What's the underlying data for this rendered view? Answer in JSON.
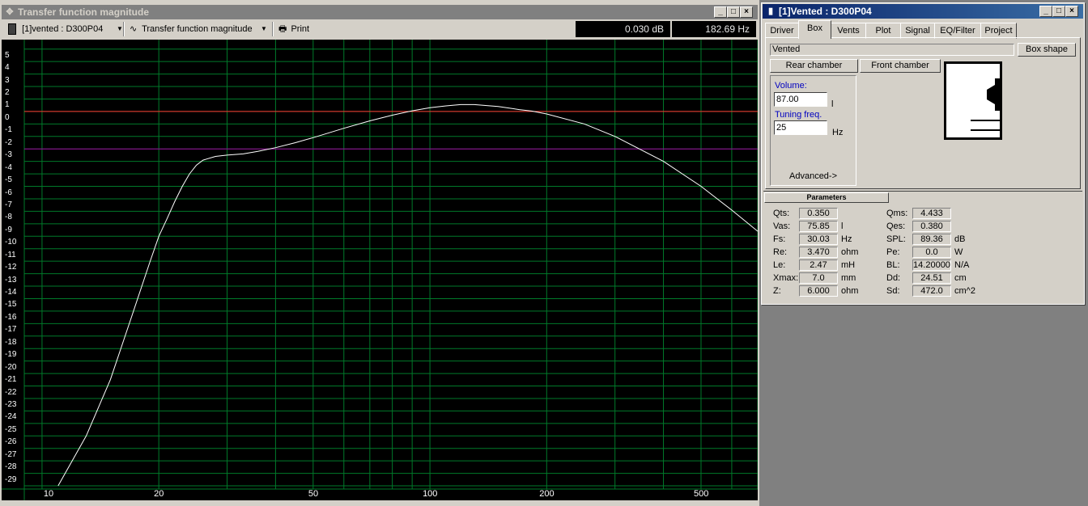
{
  "left_window": {
    "title": "Transfer function magnitude",
    "toolbar": {
      "project_select": "[1]vented : D300P04",
      "view_select": "Transfer function magnitude",
      "print_label": "Print",
      "readout_db": "0.030 dB",
      "readout_hz": "182.69 Hz"
    }
  },
  "chart_data": {
    "type": "line",
    "xscale": "log",
    "xlim": [
      9,
      700
    ],
    "ylim": [
      -30,
      5.5
    ],
    "x_ticks": [
      "10",
      "20",
      "50",
      "100",
      "200",
      "500"
    ],
    "y_ticks": [
      "5",
      "4",
      "3",
      "2",
      "1",
      "0",
      "-1",
      "-2",
      "-3",
      "-4",
      "-5",
      "-6",
      "-7",
      "-8",
      "-9",
      "-10",
      "-11",
      "-12",
      "-13",
      "-14",
      "-15",
      "-16",
      "-17",
      "-18",
      "-19",
      "-20",
      "-21",
      "-22",
      "-23",
      "-24",
      "-25",
      "-26",
      "-27",
      "-28",
      "-29"
    ],
    "reference_lines": [
      {
        "y": 0,
        "color": "#ff3030"
      },
      {
        "y": -3,
        "color": "#a000a0"
      }
    ],
    "grid": true,
    "grid_color": "#007a2a",
    "background": "#000000",
    "series": [
      {
        "color": "#ffffff",
        "points": [
          [
            11,
            -30
          ],
          [
            13,
            -26
          ],
          [
            15,
            -21.5
          ],
          [
            17,
            -16.5
          ],
          [
            19,
            -12
          ],
          [
            20,
            -10
          ],
          [
            21,
            -8.6
          ],
          [
            22,
            -7.2
          ],
          [
            23,
            -6.0
          ],
          [
            24,
            -5.0
          ],
          [
            25,
            -4.3
          ],
          [
            26,
            -3.9
          ],
          [
            28,
            -3.6
          ],
          [
            30,
            -3.5
          ],
          [
            33,
            -3.4
          ],
          [
            36,
            -3.2
          ],
          [
            40,
            -2.9
          ],
          [
            45,
            -2.5
          ],
          [
            50,
            -2.1
          ],
          [
            60,
            -1.35
          ],
          [
            70,
            -0.75
          ],
          [
            80,
            -0.3
          ],
          [
            90,
            0.05
          ],
          [
            100,
            0.3
          ],
          [
            110,
            0.45
          ],
          [
            120,
            0.55
          ],
          [
            130,
            0.55
          ],
          [
            150,
            0.4
          ],
          [
            170,
            0.15
          ],
          [
            183,
            0.03
          ],
          [
            200,
            -0.2
          ],
          [
            250,
            -1.0
          ],
          [
            300,
            -2.0
          ],
          [
            400,
            -4.0
          ],
          [
            500,
            -6.0
          ],
          [
            600,
            -7.9
          ],
          [
            700,
            -9.6
          ]
        ]
      }
    ]
  },
  "right_window": {
    "title": "[1]Vented : D300P04",
    "tabs": [
      "Driver",
      "Box",
      "Vents",
      "Plot",
      "Signal",
      "EQ/Filter",
      "Project"
    ],
    "selected_tab": "Box",
    "box_type": "Vented",
    "box_shape_button": "Box shape",
    "rear_chamber_button": "Rear chamber",
    "front_chamber_button": "Front chamber",
    "volume_label": "Volume:",
    "volume_value": "87.00",
    "volume_unit": "l",
    "tuning_label": "Tuning freq.",
    "tuning_value": "25",
    "tuning_unit": "Hz",
    "advanced_label": "Advanced->",
    "parameters_header": "Parameters",
    "params_left": [
      {
        "name": "Qts:",
        "value": "0.350",
        "unit": ""
      },
      {
        "name": "Vas:",
        "value": "75.85",
        "unit": "l"
      },
      {
        "name": "Fs:",
        "value": "30.03",
        "unit": "Hz"
      },
      {
        "name": "Re:",
        "value": "3.470",
        "unit": "ohm"
      },
      {
        "name": "Le:",
        "value": "2.47",
        "unit": "mH"
      },
      {
        "name": "Xmax:",
        "value": "7.0",
        "unit": "mm"
      },
      {
        "name": "Z:",
        "value": "6.000",
        "unit": "ohm"
      }
    ],
    "params_right": [
      {
        "name": "Qms:",
        "value": "4.433",
        "unit": ""
      },
      {
        "name": "Qes:",
        "value": "0.380",
        "unit": ""
      },
      {
        "name": "SPL:",
        "value": "89.36",
        "unit": "dB"
      },
      {
        "name": "Pe:",
        "value": "0.0",
        "unit": "W"
      },
      {
        "name": "BL:",
        "value": "14.20000",
        "unit": "N/A"
      },
      {
        "name": "Dd:",
        "value": "24.51",
        "unit": "cm"
      },
      {
        "name": "Sd:",
        "value": "472.0",
        "unit": "cm^2"
      }
    ]
  },
  "icons": {
    "window_left": "move-icon",
    "window_right": "speaker-icon",
    "toolbar_project": "speaker-icon",
    "toolbar_view": "wave-icon",
    "toolbar_print": "printer-icon"
  }
}
